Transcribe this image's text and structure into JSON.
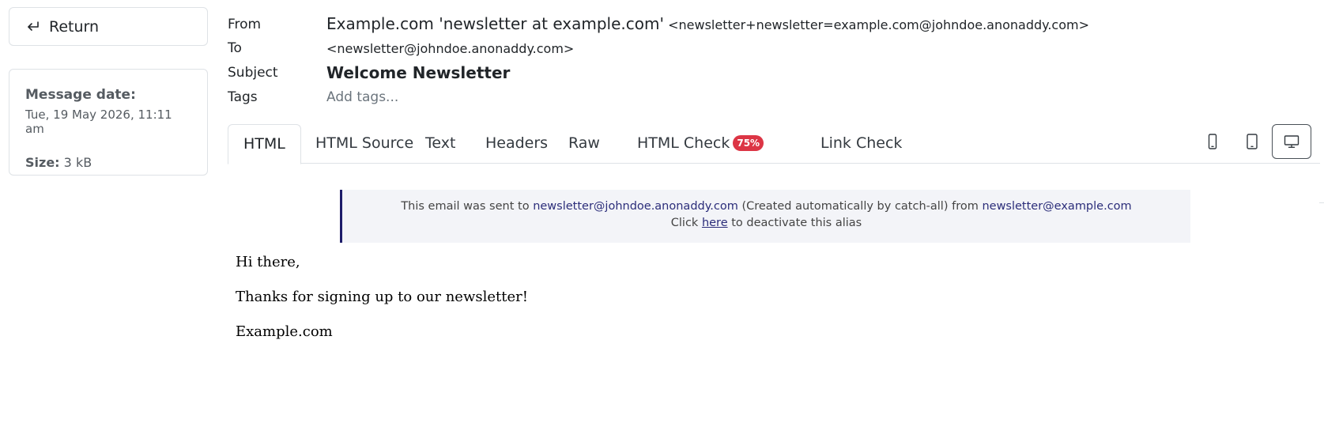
{
  "sidebar": {
    "return_label": "Return",
    "message_date_label": "Message date:",
    "message_date": "Tue, 19 May 2026, 11:11 am",
    "size_label": "Size:",
    "size_value": "3 kB"
  },
  "headers": {
    "from_label": "From",
    "from_name": "Example.com 'newsletter at example.com'",
    "from_address": "<newsletter+newsletter=example.com@johndoe.anonaddy.com>",
    "to_label": "To",
    "to_address": "<newsletter@johndoe.anonaddy.com>",
    "subject_label": "Subject",
    "subject": "Welcome Newsletter",
    "tags_label": "Tags",
    "tags_placeholder": "Add tags..."
  },
  "tabs": [
    {
      "label": "HTML",
      "active": true
    },
    {
      "label": "HTML Source"
    },
    {
      "label": "Text"
    },
    {
      "label": "Headers"
    },
    {
      "label": "Raw"
    },
    {
      "label": "HTML Check",
      "badge": "75%"
    },
    {
      "label": "Link Check"
    }
  ],
  "device_buttons": [
    {
      "icon": "mobile-phone-icon"
    },
    {
      "icon": "tablet-icon"
    },
    {
      "icon": "desktop-monitor-icon",
      "active": true
    }
  ],
  "notice": {
    "prefix": "This email was sent to",
    "alias": "newsletter@johndoe.anonaddy.com",
    "middle": "(Created automatically by catch-all) from",
    "sender": "newsletter@example.com",
    "line2_prefix": "Click",
    "line2_link": "here",
    "line2_suffix": "to deactivate this alias"
  },
  "email_body": {
    "greeting": "Hi there,",
    "message": "Thanks for signing up to our newsletter!",
    "signature": "Example.com"
  },
  "colors": {
    "badge": "#dc3545",
    "notice_bg": "#f3f4f8",
    "notice_border": "#1d1c69",
    "link": "#2b2d7a"
  }
}
